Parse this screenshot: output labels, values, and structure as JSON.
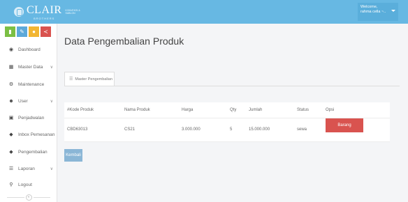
{
  "header": {
    "logo_text": "CLAIR",
    "logo_sub": "BROTHERS",
    "logo_tagline": "KONVEKSI & SABLON",
    "welcome_line1": "Welcome,",
    "welcome_line2": "rahma cella ~.."
  },
  "sidebar": {
    "quick_icons": [
      "chart-icon",
      "pencil-icon",
      "users-icon",
      "share-icon"
    ],
    "items": [
      {
        "label": "Dashboard",
        "icon": "dashboard-icon",
        "has_chevron": false
      },
      {
        "label": "Master Data",
        "icon": "table-icon",
        "has_chevron": true
      },
      {
        "label": "Maintenance",
        "icon": "gears-icon",
        "has_chevron": false
      },
      {
        "label": "User",
        "icon": "users-icon",
        "has_chevron": true
      },
      {
        "label": "Penjadwalan",
        "icon": "calendar-icon",
        "has_chevron": false
      },
      {
        "label": "Inbox Pemesanan",
        "icon": "tag-icon",
        "has_chevron": false
      },
      {
        "label": "Pengembalian",
        "icon": "tag-icon",
        "has_chevron": false
      },
      {
        "label": "Laporan",
        "icon": "list-icon",
        "has_chevron": true
      },
      {
        "label": "Logout",
        "icon": "key-icon",
        "has_chevron": false
      }
    ],
    "chevron": "∨",
    "collapse_symbol": "«"
  },
  "main": {
    "title": "Data Pengembalian Produk",
    "tab_label": "Master Pengembalian",
    "table": {
      "columns": [
        "#Kode Produk",
        "Nama Produk",
        "Harga",
        "Qty",
        "Jumlah",
        "Status",
        "Opsi"
      ],
      "rows": [
        {
          "kode": "CBD63013",
          "nama": "CS21",
          "harga": "3.000.000",
          "qty": "5",
          "jumlah": "15.000.000",
          "status": "sewa",
          "action": "Barang Kembali"
        }
      ]
    },
    "back_label": "Kembali"
  },
  "colors": {
    "topbar": "#67b8e3",
    "action_red": "#d9534f",
    "back_button": "#8ab6d6"
  }
}
